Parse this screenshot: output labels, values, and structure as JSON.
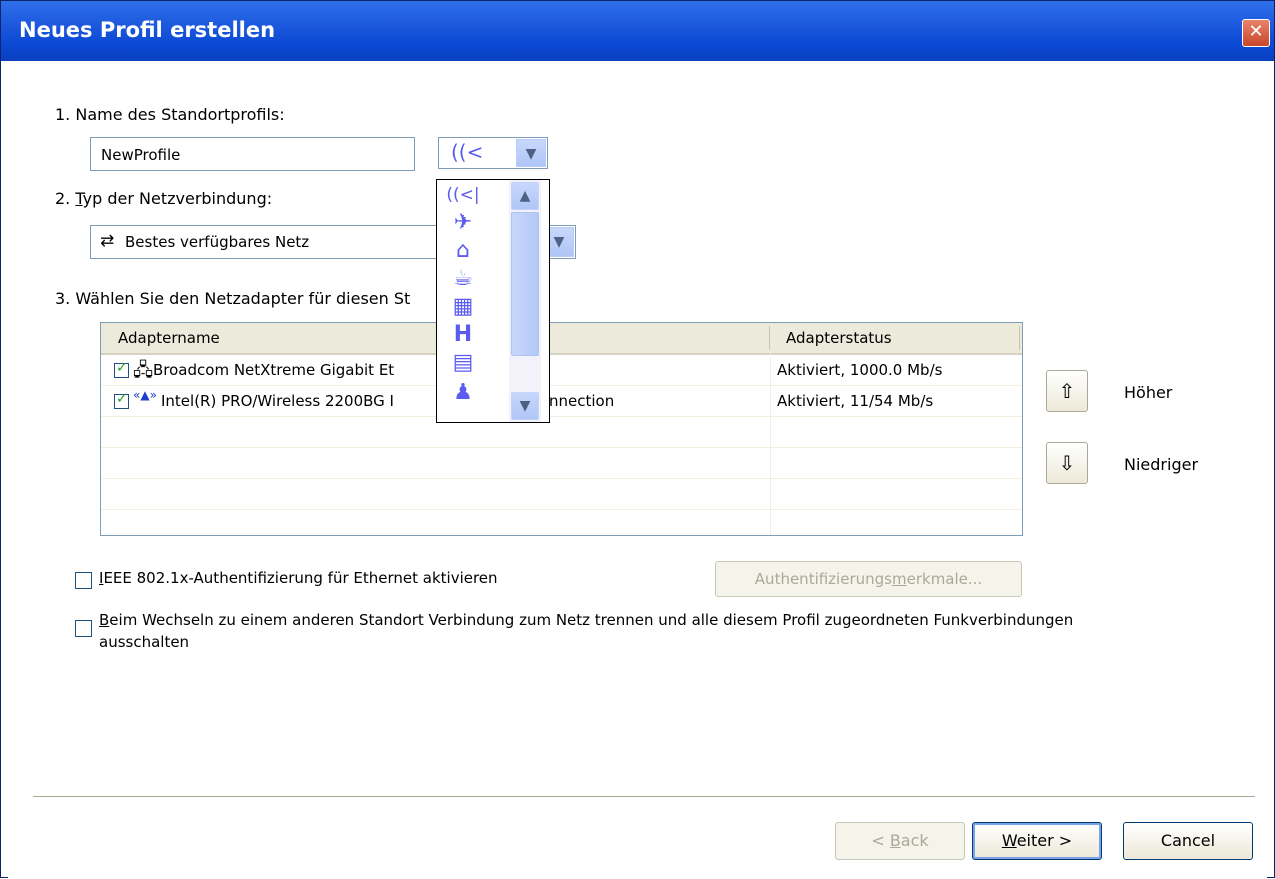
{
  "window": {
    "title": "Neues Profil erstellen",
    "close_glyph": "✕"
  },
  "step1": {
    "label": "1. Name des Standortprofils:",
    "name_value": "NewProfile",
    "icon_selected": "wireless-icon"
  },
  "step2": {
    "label_prefix": "2. ",
    "label_underline": "T",
    "label_rest": "yp der Netzverbindung:",
    "connection_type": "Bestes verfügbares Netz"
  },
  "step3": {
    "label": "3. Wählen Sie den Netzadapter für diesen St"
  },
  "adapter_table": {
    "columns": [
      "Adaptername",
      "Adapterstatus"
    ],
    "rows": [
      {
        "name": "Broadcom NetXtreme Gigabit Et",
        "status": "Aktiviert, 1000.0 Mb/s",
        "checked": true,
        "icon": "ethernet-icon"
      },
      {
        "name": "Intel(R) PRO/Wireless 2200BG I",
        "name_tail": "nnection",
        "status": "Aktiviert, 11/54 Mb/s",
        "checked": true,
        "icon": "wireless-antenna-icon"
      }
    ]
  },
  "icon_dropdown": {
    "items": [
      "wireless-icon",
      "airplane-icon",
      "home-icon",
      "coffee-icon",
      "office-building-icon",
      "hotel-icon",
      "train-icon",
      "person-icon"
    ]
  },
  "side_buttons": {
    "up_label": "Höher",
    "down_label": "Niedriger"
  },
  "options": {
    "ieee_prefix": "",
    "ieee_underline": "I",
    "ieee_rest": "EEE 802.1x-Authentifizierung für Ethernet aktivieren",
    "auth_button_prefix": "Authentifizierungs",
    "auth_button_underline": "m",
    "auth_button_rest": "erkmale...",
    "switch_underline": "B",
    "switch_rest_line1": "eim Wechseln zu einem anderen Standort Verbindung zum Netz trennen und alle diesem Profil zugeordneten Funkverbindungen",
    "switch_line2": "ausschalten"
  },
  "footer": {
    "back_prefix": "< ",
    "back_underline": "B",
    "back_rest": "ack",
    "next_underline": "W",
    "next_rest": "eiter >",
    "cancel_label": "Cancel"
  }
}
